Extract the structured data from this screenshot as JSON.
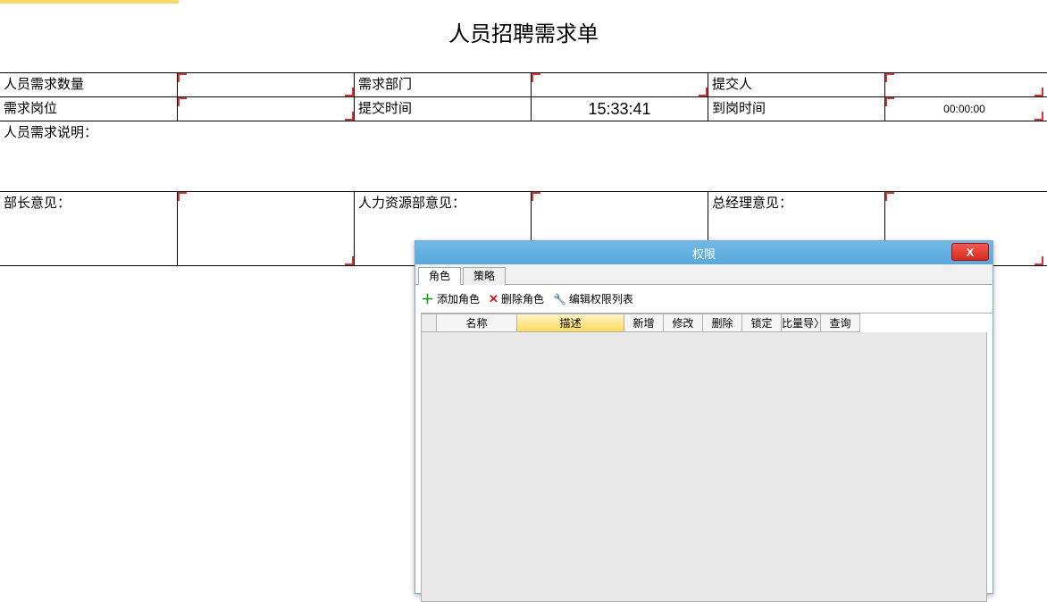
{
  "form": {
    "title": "人员招聘需求单",
    "row1": {
      "qty_label": "人员需求数量",
      "qty_val": "",
      "dept_label": "需求部门",
      "dept_val": "",
      "submitter_label": "提交人",
      "submitter_val": ""
    },
    "row2": {
      "pos_label": "需求岗位",
      "pos_val": "",
      "submit_time_label": "提交时间",
      "submit_time_val": "15:33:41",
      "arrive_time_label": "到岗时间",
      "arrive_time_val": "00:00:00"
    },
    "desc_label": "人员需求说明：",
    "row_opinions": {
      "mgr_opinion_label": "部长意见：",
      "mgr_opinion_val": "",
      "hr_opinion_label": "人力资源部意见：",
      "hr_opinion_val": "",
      "gm_opinion_label": "总经理意见：",
      "gm_opinion_val": ""
    }
  },
  "dialog": {
    "title": "权限",
    "close": "X",
    "tabs": [
      "角色",
      "策略"
    ],
    "toolbar": {
      "add_role": "添加角色",
      "del_role": "删除角色",
      "edit_perm": "编辑权限列表"
    },
    "columns": {
      "name": "名称",
      "desc": "描述",
      "add": "新增",
      "edit": "修改",
      "delete": "删除",
      "lock": "锁定",
      "batch": "比量导〉",
      "query": "查询"
    }
  }
}
